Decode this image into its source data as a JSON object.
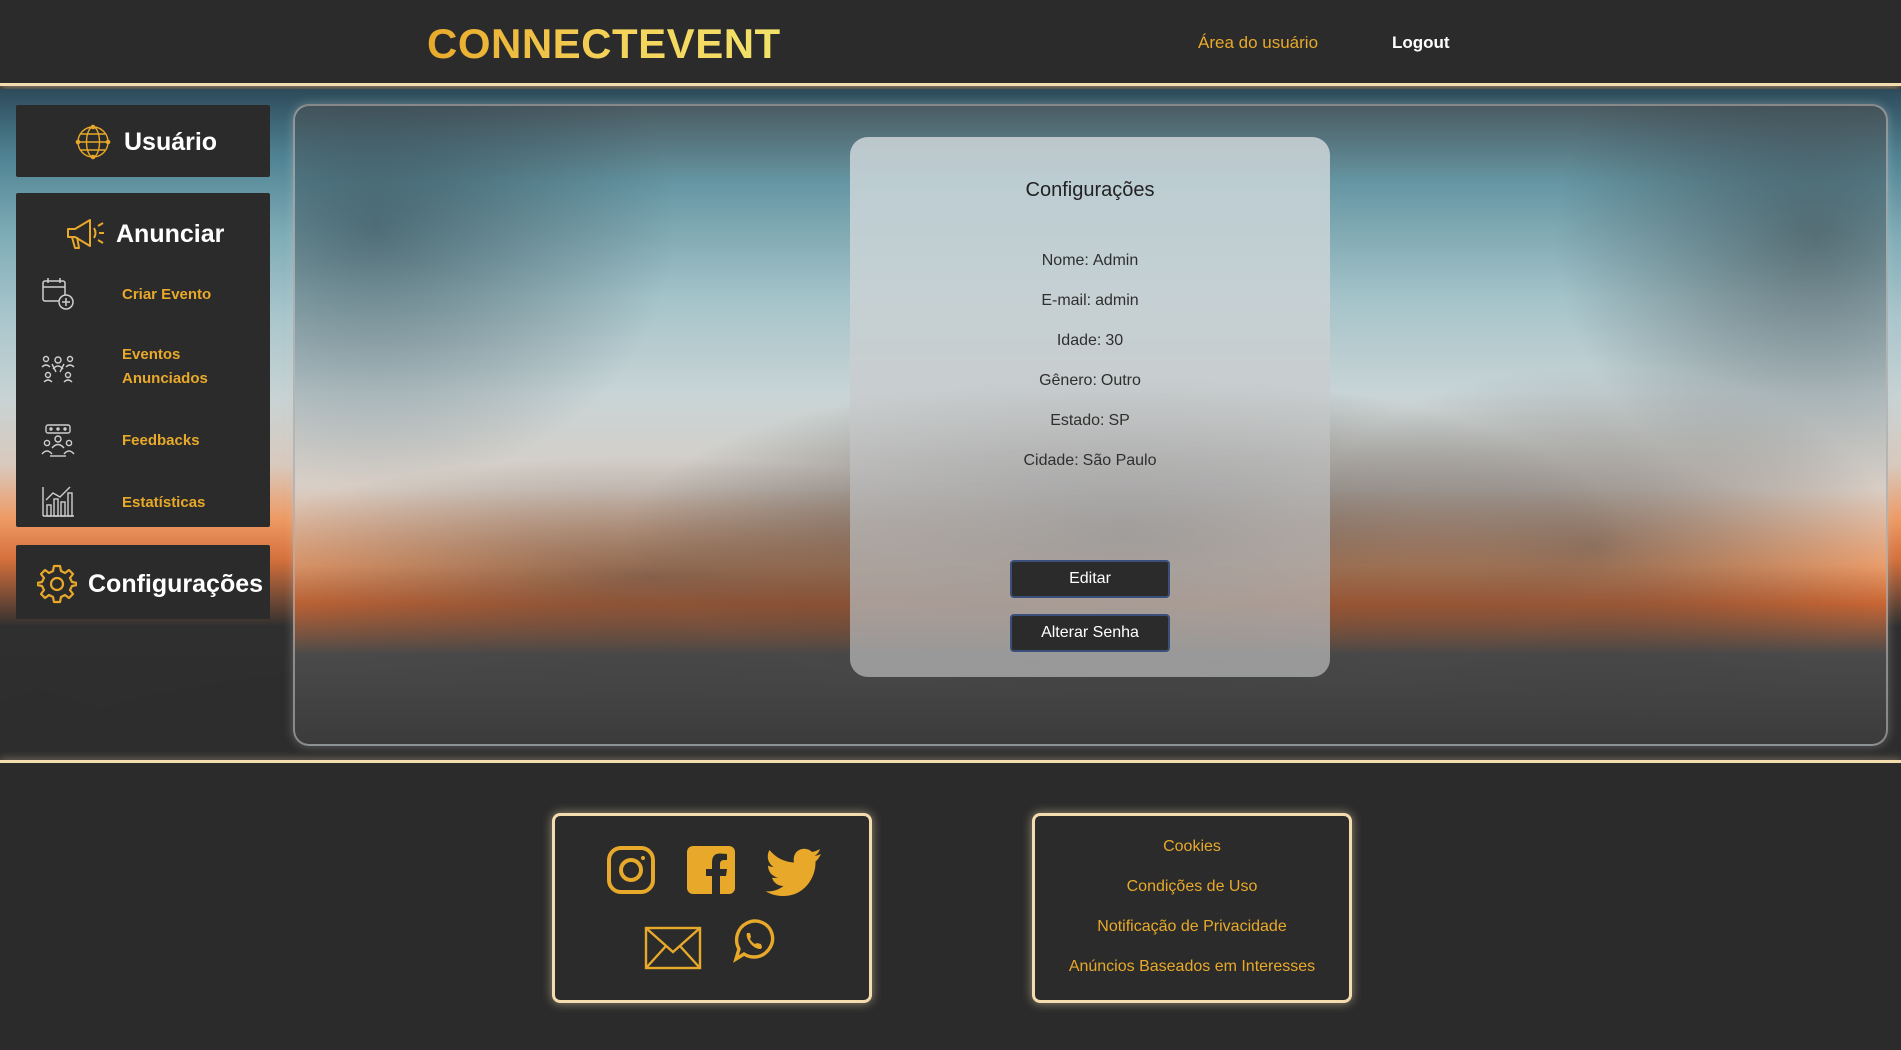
{
  "header": {
    "brand": "CONNECTEVENT",
    "nav_user": "Área do usuário",
    "nav_logout": "Logout"
  },
  "sidebar": {
    "user_label": "Usuário",
    "announce_label": "Anunciar",
    "announce_items": [
      {
        "label": "Criar Evento",
        "icon": "calendar-add-icon"
      },
      {
        "label": "Eventos Anunciados",
        "icon": "people-network-icon"
      },
      {
        "label": "Feedbacks",
        "icon": "feedback-group-icon"
      },
      {
        "label": "Estatísticas",
        "icon": "bar-chart-icon"
      }
    ],
    "config_label": "Configurações"
  },
  "card": {
    "title": "Configurações",
    "fields": [
      {
        "label": "Nome:",
        "value": "Admin"
      },
      {
        "label": "E-mail:",
        "value": "admin"
      },
      {
        "label": "Idade:",
        "value": "30"
      },
      {
        "label": "Gênero:",
        "value": "Outro"
      },
      {
        "label": "Estado:",
        "value": "SP"
      },
      {
        "label": "Cidade:",
        "value": "São Paulo"
      }
    ],
    "edit_button": "Editar",
    "password_button": "Alterar Senha"
  },
  "footer": {
    "social": [
      "instagram-icon",
      "facebook-icon",
      "twitter-icon",
      "email-icon",
      "whatsapp-icon"
    ],
    "links": [
      "Cookies",
      "Condições de Uso",
      "Notificação de Privacidade",
      "Anúncios Baseados em Interesses"
    ]
  },
  "colors": {
    "accent": "#e8a92a",
    "frame_glow": "#f3dcae",
    "panel": "#2b2b2b"
  }
}
